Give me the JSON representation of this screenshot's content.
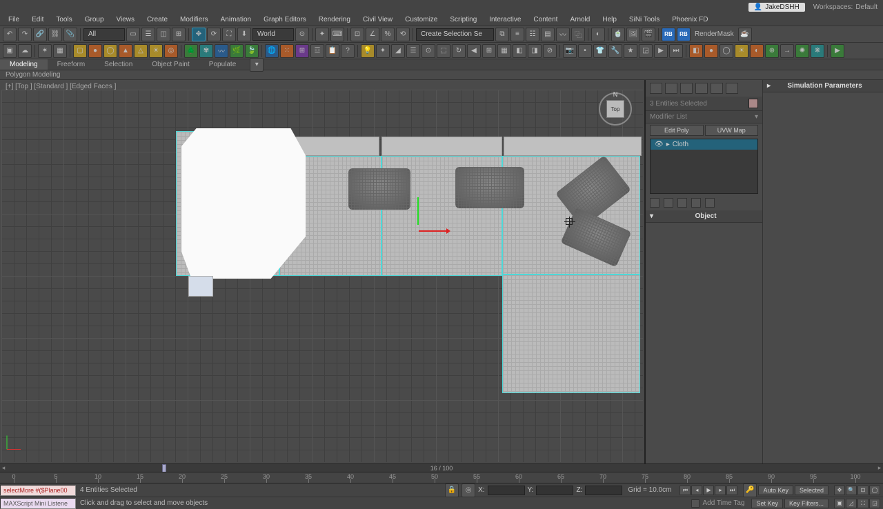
{
  "titlebar": {
    "user": "JakeDSHH",
    "workspace_label": "Workspaces:",
    "workspace_value": "Default"
  },
  "menus": [
    "File",
    "Edit",
    "Tools",
    "Group",
    "Views",
    "Create",
    "Modifiers",
    "Animation",
    "Graph Editors",
    "Rendering",
    "Civil View",
    "Customize",
    "Scripting",
    "Interactive",
    "Content",
    "Arnold",
    "Help",
    "SiNi Tools",
    "Phoenix FD"
  ],
  "toolbar1": {
    "select_set_label": "All",
    "coord_label": "World",
    "select_set2": "Create Selection Se",
    "render_mask": "RenderMask",
    "rb": "RB"
  },
  "ribbon": {
    "tabs": [
      "Modeling",
      "Freeform",
      "Selection",
      "Object Paint",
      "Populate"
    ],
    "active": 0,
    "sub": "Polygon Modeling"
  },
  "viewport": {
    "label": "[+] [Top ] [Standard ] [Edged Faces ]",
    "viewcube": "Top",
    "viewcube_n": "N"
  },
  "cmdpanel": {
    "selection_info": "3 Entities Selected",
    "modifier_list": "Modifier List",
    "buttons": {
      "edit_poly": "Edit Poly",
      "uvw_map": "UVW Map"
    },
    "stack": [
      "Cloth"
    ],
    "rollout_sim": "Simulation Parameters",
    "rollout_obj": "Object"
  },
  "timeline": {
    "frame_display": "16 / 100",
    "ticks": [
      0,
      5,
      10,
      15,
      20,
      25,
      30,
      35,
      40,
      45,
      50,
      55,
      60,
      65,
      70,
      75,
      80,
      85,
      90,
      95,
      100
    ]
  },
  "status": {
    "script": "selectMore #($Plane00",
    "listener": "MAXScript Mini Listene",
    "entities": "4 Entities Selected",
    "prompt": "Click and drag to select and move objects",
    "coord_x": "X:",
    "coord_y": "Y:",
    "coord_z": "Z:",
    "grid": "Grid = 10.0cm",
    "time_tag": "Add Time Tag",
    "auto_key": "Auto Key",
    "set_key": "Set Key",
    "selected": "Selected",
    "key_filters": "Key Filters..."
  }
}
